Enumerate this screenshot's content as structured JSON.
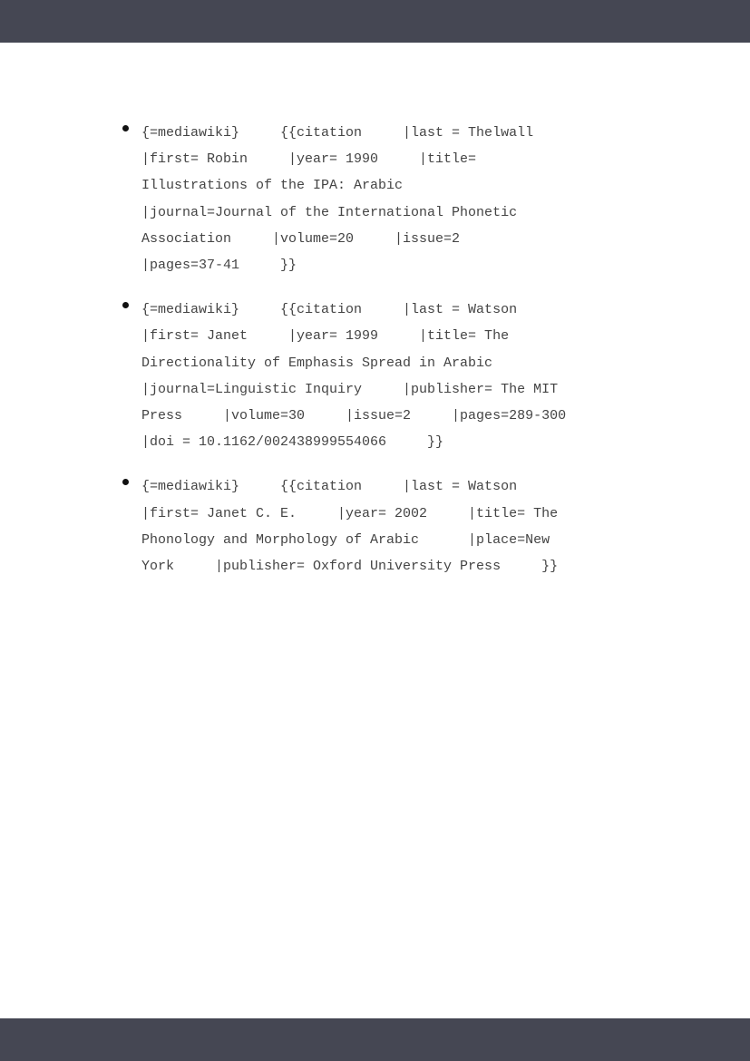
{
  "references": [
    {
      "lines": [
        "{=mediawiki}     {{citation     |last = Thelwall",
        "|first= Robin     |year= 1990     |title=",
        "Illustrations of the IPA: Arabic",
        "|journal=Journal of the International Phonetic",
        "Association     |volume=20     |issue=2",
        "|pages=37-41     }}"
      ]
    },
    {
      "lines": [
        "{=mediawiki}     {{citation     |last = Watson",
        "|first= Janet     |year= 1999     |title= The",
        "Directionality of Emphasis Spread in Arabic",
        "|journal=Linguistic Inquiry     |publisher= The MIT",
        "Press     |volume=30     |issue=2     |pages=289-300",
        "|doi = 10.1162/002438999554066     }}"
      ]
    },
    {
      "lines": [
        "{=mediawiki}     {{citation     |last = Watson",
        "|first= Janet C. E.     |year= 2002     |title= The",
        "Phonology and Morphology of Arabic      |place=New",
        "York     |publisher= Oxford University Press     }}"
      ]
    }
  ]
}
